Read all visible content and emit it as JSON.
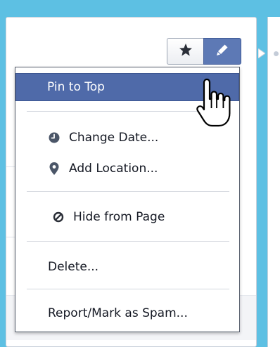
{
  "colors": {
    "background": "#5dc0e3",
    "accent": "#4f6aa9",
    "icon_gray": "#4b5668",
    "text": "#141823"
  },
  "header_buttons": {
    "star_icon": "star-icon",
    "edit_icon": "pencil-icon"
  },
  "menu": {
    "pin_to_top": "Pin to Top",
    "change_date": "Change Date...",
    "add_location": "Add Location...",
    "hide_from_page": "Hide from Page",
    "delete": "Delete...",
    "report_spam": "Report/Mark as Spam..."
  }
}
